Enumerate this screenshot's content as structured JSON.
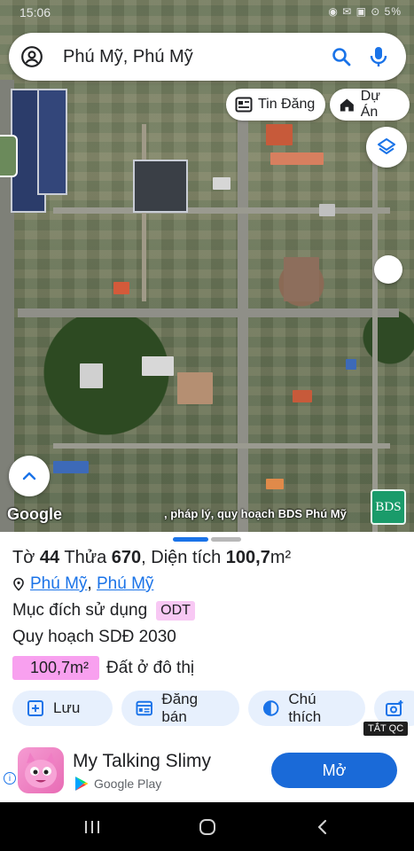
{
  "status_bar": {
    "time": "15:06",
    "right_text": "◉ ✉ ▣ ⊙ 5%"
  },
  "search": {
    "query": "Phú Mỹ, Phú Mỹ"
  },
  "map_chips": {
    "listings_label": "Tin Đăng",
    "projects_label": "Dự Án"
  },
  "map_overlay": {
    "attribution": "Google",
    "caption": ", pháp lý, quy hoạch BDS Phú Mỹ",
    "badge_text": "BDS"
  },
  "panel": {
    "title_prefix": "Tờ",
    "sheet_no": "44",
    "parcel_label": "Thửa",
    "parcel_no": "670",
    "area_label": ", Diện tích",
    "area_value": "100,7",
    "area_unit": "m²",
    "location_link_1": "Phú Mỹ",
    "location_sep": ",",
    "location_link_2": "Phú Mỹ",
    "purpose_label": "Mục đích sử dụng",
    "purpose_code": "ODT",
    "plan_label": "Quy hoạch SDĐ 2030",
    "land_area": "100,7m²",
    "land_type": "Đất ở đô thị"
  },
  "actions": {
    "save": "Lưu",
    "post_sale": "Đăng bán",
    "legend": "Chú thích",
    "turn_off_ads": "TẮT QC"
  },
  "ad": {
    "info": "i",
    "title": "My Talking Slimy",
    "store": "Google Play",
    "open_label": "Mở"
  },
  "colors": {
    "accent": "#1a73e8",
    "odt_badge": "#f8c8f4",
    "area_chip": "#f8a0ef",
    "ad_button": "#1a6ad8",
    "bds_badge": "#1a9b6a"
  },
  "icons": {
    "account": "account-circle-icon",
    "search": "search-icon",
    "mic": "microphone-icon",
    "listings": "newspaper-icon",
    "projects": "house-icon",
    "layers": "layers-icon",
    "location": "location-pin-icon",
    "save": "add-square-icon",
    "post_sale": "listing-icon",
    "legend": "half-circle-icon",
    "camera": "camera-add-icon",
    "collapse": "chevron-up-icon"
  }
}
